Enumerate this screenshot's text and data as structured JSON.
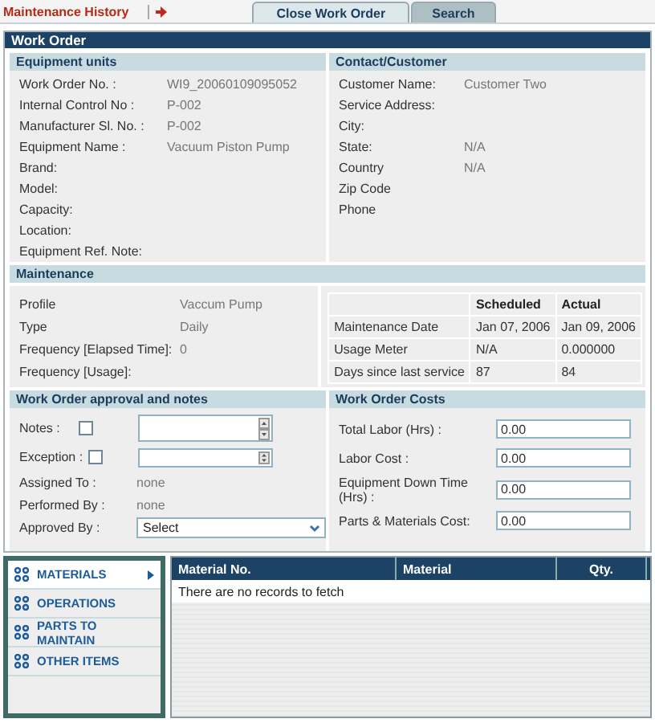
{
  "header": {
    "title": "Maintenance History"
  },
  "tabs": [
    {
      "label": "Close Work Order",
      "selected": true
    },
    {
      "label": "Search",
      "selected": false
    }
  ],
  "work_order": {
    "title": "Work Order",
    "equipment_units": {
      "title": "Equipment units",
      "fields": [
        {
          "label": "Work Order No. :",
          "value": "WI9_20060109095052"
        },
        {
          "label": "Internal Control No :",
          "value": "P-002"
        },
        {
          "label": "Manufacturer Sl. No. :",
          "value": "P-002"
        },
        {
          "label": "Equipment Name :",
          "value": "Vacuum Piston Pump"
        },
        {
          "label": "Brand:"
        },
        {
          "label": "Model:"
        },
        {
          "label": "Capacity:"
        },
        {
          "label": "Location:"
        },
        {
          "label": "Equipment Ref. Note:"
        }
      ]
    },
    "contact": {
      "title": "Contact/Customer",
      "fields": [
        {
          "label": "Customer Name:",
          "value": "Customer Two"
        },
        {
          "label": "Service Address:"
        },
        {
          "label": "City:"
        },
        {
          "label": "State:",
          "value": "N/A"
        },
        {
          "label": "Country",
          "value": "N/A"
        },
        {
          "label": "Zip Code"
        },
        {
          "label": "Phone"
        }
      ]
    },
    "maintenance": {
      "title": "Maintenance",
      "fields": [
        {
          "label": "Profile",
          "value": "Vaccum Pump"
        },
        {
          "label": "Type",
          "value": "Daily"
        },
        {
          "label": "Frequency [Elapsed Time]:",
          "value": "0"
        },
        {
          "label": "Frequency [Usage]:"
        }
      ],
      "table": {
        "columns": [
          "Scheduled",
          "Actual"
        ],
        "rows": [
          {
            "label": "Maintenance Date",
            "scheduled": "Jan 07, 2006",
            "actual": "Jan 09, 2006"
          },
          {
            "label": "Usage Meter",
            "scheduled": "N/A",
            "actual": "0.000000"
          },
          {
            "label": "Days since last service",
            "scheduled": "87",
            "actual": "84"
          }
        ]
      }
    },
    "approval": {
      "title": "Work Order approval and notes",
      "rows": [
        {
          "kind": "check_notes",
          "label": "Notes :",
          "checked": false
        },
        {
          "kind": "check_spin",
          "label": "Exception :",
          "checked": false
        },
        {
          "kind": "text",
          "label": "Assigned To :",
          "value": "none"
        },
        {
          "kind": "text",
          "label": "Performed By :",
          "value": "none"
        },
        {
          "kind": "select",
          "label": "Approved By :",
          "value": "Select"
        }
      ]
    },
    "costs": {
      "title": "Work Order Costs",
      "fields": [
        {
          "label": "Total Labor (Hrs) :",
          "value": "0.00"
        },
        {
          "label": "Labor Cost :",
          "value": "0.00"
        },
        {
          "label": "Equipment Down Time (Hrs) :",
          "value": "0.00"
        },
        {
          "label": "Parts & Materials Cost:",
          "value": "0.00"
        }
      ]
    }
  },
  "side_menu": {
    "items": [
      {
        "label": "MATERIALS",
        "selected": true
      },
      {
        "label": "OPERATIONS",
        "selected": false
      },
      {
        "label": "PARTS TO MAINTAIN",
        "selected": false
      },
      {
        "label": "OTHER ITEMS",
        "selected": false
      }
    ]
  },
  "materials_table": {
    "columns": [
      "Material No.",
      "Material",
      "Qty."
    ],
    "empty_message": "There are no records to fetch"
  }
}
